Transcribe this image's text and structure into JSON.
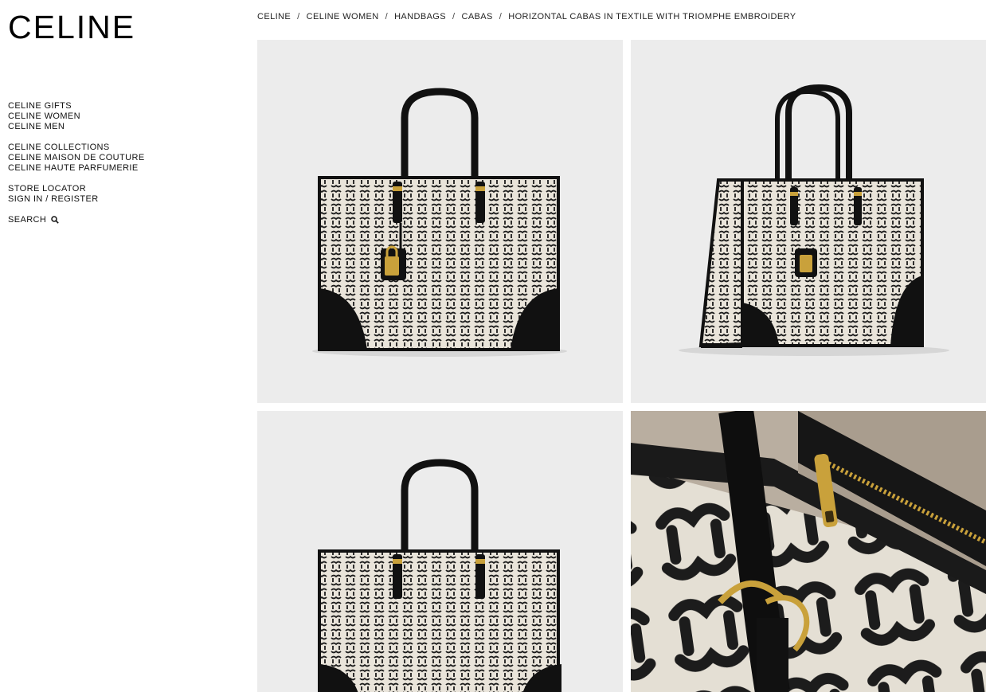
{
  "brand": {
    "logo_text": "CELINE"
  },
  "nav": {
    "group1": [
      "CELINE GIFTS",
      "CELINE WOMEN",
      "CELINE MEN"
    ],
    "group2": [
      "CELINE COLLECTIONS",
      "CELINE MAISON DE COUTURE",
      "CELINE HAUTE PARFUMERIE"
    ],
    "group3": [
      "STORE LOCATOR",
      "SIGN IN / REGISTER"
    ],
    "search_label": "SEARCH",
    "search_icon": "magnifier-icon"
  },
  "breadcrumb": {
    "items": [
      "CELINE",
      "CELINE WOMEN",
      "HANDBAGS",
      "CABAS",
      "HORIZONTAL CABAS IN TEXTILE WITH TRIOMPHE EMBROIDERY"
    ],
    "separator": "/"
  },
  "gallery": {
    "images": [
      "front-view",
      "three-quarter-view",
      "front-view-cropped",
      "detail-close-up"
    ]
  },
  "colors": {
    "tile_background": "#ececec",
    "leather": "#111111",
    "canvas": "#e9e4da",
    "gold": "#c9a13b"
  }
}
